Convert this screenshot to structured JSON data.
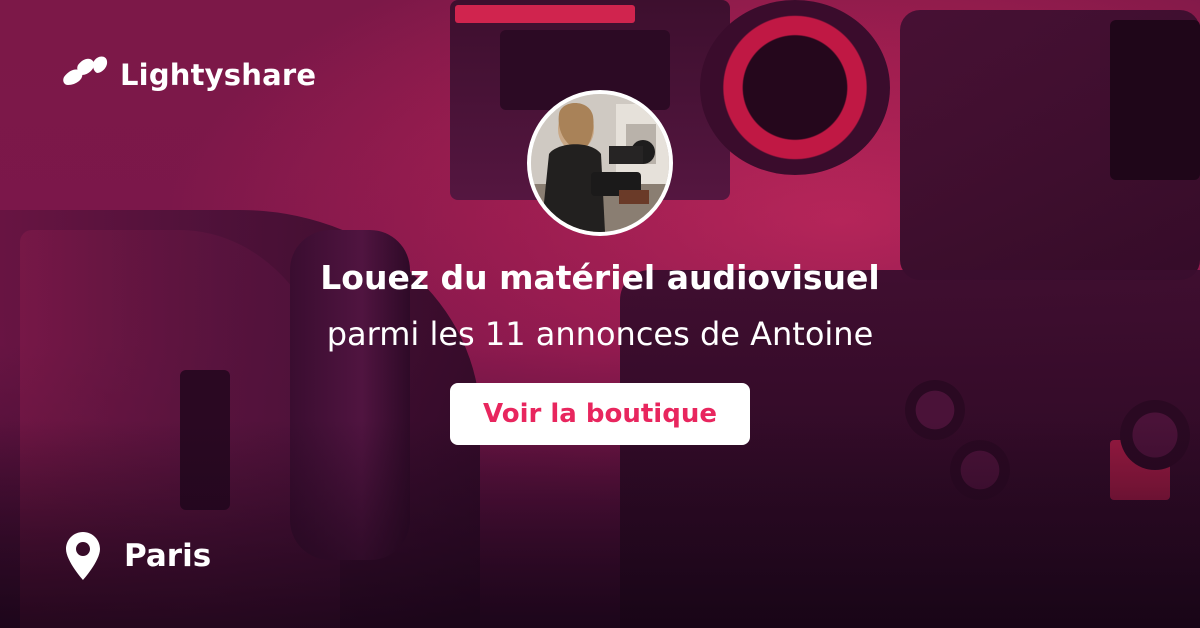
{
  "brand": {
    "name": "Lightyshare",
    "logo_icon": "lightyshare-logo-icon"
  },
  "profile": {
    "avatar_icon": "profile-photo"
  },
  "hero": {
    "headline": "Louez du matériel audiovisuel",
    "subline": "parmi les 11 annonces de Antoine"
  },
  "cta": {
    "label": "Voir la boutique"
  },
  "location": {
    "icon": "map-pin-icon",
    "city": "Paris"
  },
  "colors": {
    "accent": "#e8265e",
    "background": "#a51f50",
    "text": "#ffffff"
  }
}
